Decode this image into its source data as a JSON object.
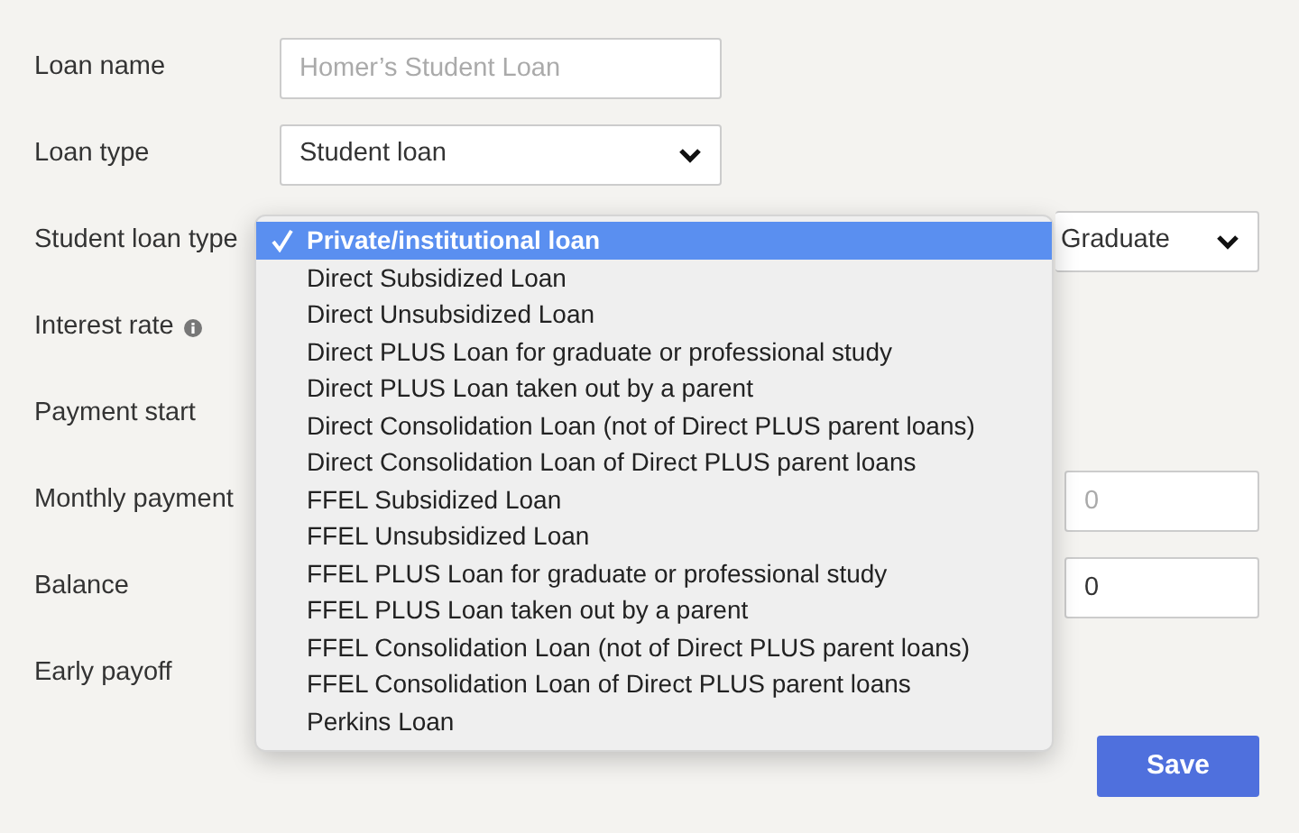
{
  "fields": [
    {
      "label": "Loan name",
      "kind": "text",
      "placeholder": "Homer’s Student Loan"
    },
    {
      "label": "Loan type",
      "kind": "select",
      "value": "Student loan"
    },
    {
      "label": "Student loan type",
      "kind": "select-right",
      "value": "Graduate"
    },
    {
      "label": "Interest rate",
      "kind": "none",
      "info": true
    },
    {
      "label": "Payment start",
      "kind": "none"
    },
    {
      "label": "Monthly payment",
      "kind": "input-right",
      "placeholder": "0"
    },
    {
      "label": "Balance",
      "kind": "input-right",
      "value": "0"
    },
    {
      "label": "Early payoff",
      "kind": "none"
    }
  ],
  "save_button": "Save",
  "menu": {
    "options": [
      {
        "label": "Private/institutional loan",
        "selected": true
      },
      {
        "label": "Direct Subsidized Loan",
        "selected": false
      },
      {
        "label": "Direct Unsubsidized Loan",
        "selected": false
      },
      {
        "label": "Direct PLUS Loan for graduate or professional study",
        "selected": false
      },
      {
        "label": "Direct PLUS Loan taken out by a parent",
        "selected": false
      },
      {
        "label": "Direct Consolidation Loan (not of Direct PLUS parent loans)",
        "selected": false
      },
      {
        "label": "Direct Consolidation Loan of Direct PLUS parent loans",
        "selected": false
      },
      {
        "label": "FFEL Subsidized Loan",
        "selected": false
      },
      {
        "label": "FFEL Unsubsidized Loan",
        "selected": false
      },
      {
        "label": "FFEL PLUS Loan for graduate or professional study",
        "selected": false
      },
      {
        "label": "FFEL PLUS Loan taken out by a parent",
        "selected": false
      },
      {
        "label": "FFEL Consolidation Loan (not of Direct PLUS parent loans)",
        "selected": false
      },
      {
        "label": "FFEL Consolidation Loan of Direct PLUS parent loans",
        "selected": false
      },
      {
        "label": "Perkins Loan",
        "selected": false
      }
    ]
  }
}
